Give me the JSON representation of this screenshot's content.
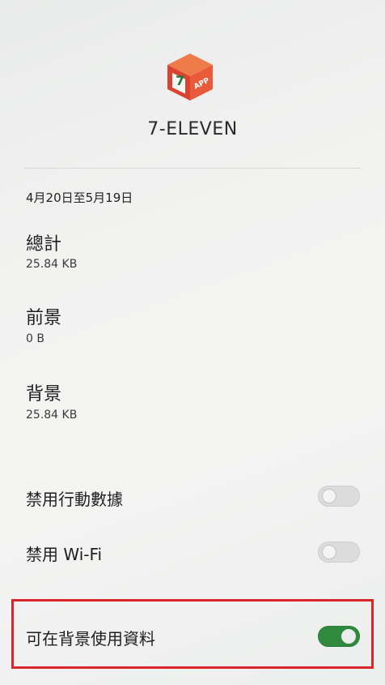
{
  "app": {
    "name": "7-ELEVEN",
    "icon_text": "APP",
    "icon_glyph": "7"
  },
  "usage": {
    "date_range": "4月20日至5月19日",
    "total_label": "總計",
    "total_value": "25.84 KB",
    "foreground_label": "前景",
    "foreground_value": "0 B",
    "background_label": "背景",
    "background_value": "25.84 KB"
  },
  "settings": [
    {
      "label": "禁用行動數據",
      "enabled": false
    },
    {
      "label": "禁用 Wi-Fi",
      "enabled": false
    },
    {
      "label": "可在背景使用資料",
      "enabled": true
    }
  ],
  "colors": {
    "toggle_on": "#2f8a3e",
    "highlight": "#d8262b",
    "app_icon": "#e6533a"
  }
}
